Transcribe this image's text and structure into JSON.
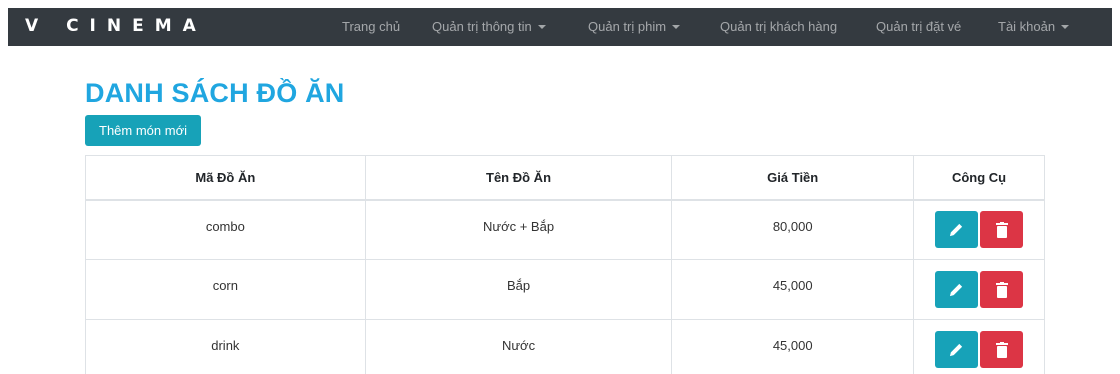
{
  "navbar": {
    "brand": "V CINEMA",
    "items": [
      {
        "label": "Trang chủ",
        "dropdown": false
      },
      {
        "label": "Quản trị thông tin",
        "dropdown": true
      },
      {
        "label": "Quản trị phim",
        "dropdown": true
      },
      {
        "label": "Quản trị khách hàng",
        "dropdown": false
      },
      {
        "label": "Quản trị đặt vé",
        "dropdown": false
      },
      {
        "label": "Tài khoản",
        "dropdown": true
      }
    ]
  },
  "main": {
    "title": "DANH SÁCH ĐỒ ĂN",
    "add_button": "Thêm món mới",
    "table": {
      "headers": [
        "Mã Đồ Ăn",
        "Tên Đồ Ăn",
        "Giá Tiền",
        "Công Cụ"
      ],
      "rows": [
        [
          "combo",
          "Nước + Bắp",
          "80,000"
        ],
        [
          "corn",
          "Bắp",
          "45,000"
        ],
        [
          "drink",
          "Nước",
          "45,000"
        ]
      ]
    }
  },
  "icons": {
    "edit": "pencil-icon",
    "delete": "trash-icon"
  },
  "colors": {
    "navbar": "#343a40",
    "title": "#20a6e0",
    "info": "#17a2b8",
    "danger": "#dc3545"
  }
}
